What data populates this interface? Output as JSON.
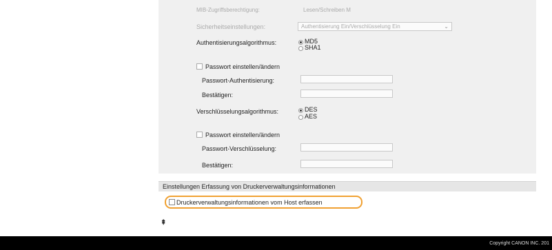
{
  "form": {
    "faded_top_label": "MIB-Zugriffsberechtigung:",
    "faded_top_value": "Lesen/Schreiben M",
    "security_settings_label": "Sicherheitseinstellungen:",
    "security_settings_value": "Authentisierung Ein/Verschlüsselung Ein",
    "auth_algo_label": "Authentisierungsalgorithmus:",
    "auth_algo_options": [
      "MD5",
      "SHA1"
    ],
    "auth_algo_selected": "MD5",
    "set_change_password_1": "Passwort einstellen/ändern",
    "password_auth_label": "Passwort-Authentisierung:",
    "confirm_label_1": "Bestätigen:",
    "encrypt_algo_label": "Verschlüsselungsalgorithmus:",
    "encrypt_algo_options": [
      "DES",
      "AES"
    ],
    "encrypt_algo_selected": "DES",
    "set_change_password_2": "Passwort einstellen/ändern",
    "password_encrypt_label": "Passwort-Verschlüsselung:",
    "confirm_label_2": "Bestätigen:"
  },
  "mgmt_info": {
    "section_title": "Einstellungen Erfassung von Druckerverwaltungsinformationen",
    "checkbox_label": "Druckerverwaltungsinformationen vom Host erfassen",
    "checked": false
  },
  "top_link_glyph": "⇞",
  "footer": {
    "copyright": "Copyright CANON INC. 201"
  },
  "colors": {
    "highlight": "#f0a030",
    "footer_bg": "#000000",
    "panel_bg": "#f0f0f0"
  }
}
